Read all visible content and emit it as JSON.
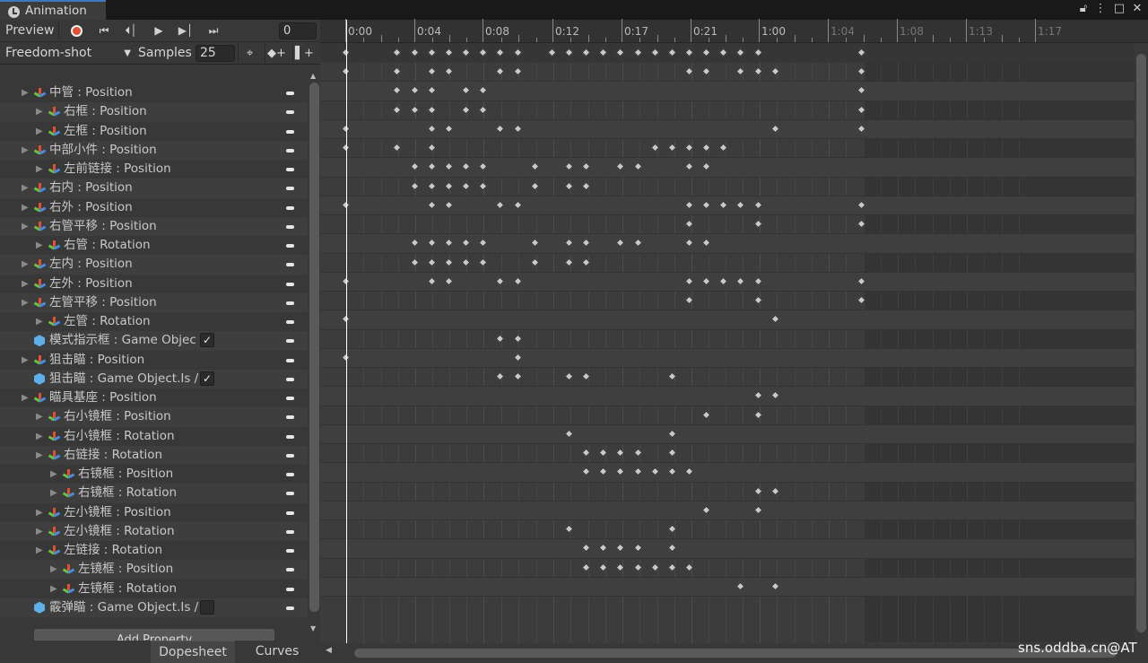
{
  "window": {
    "tab_title": "Animation"
  },
  "toolbar": {
    "preview_label": "Preview",
    "frame_value": "0"
  },
  "clip": {
    "name": "Freedom-shot",
    "samples_label": "Samples",
    "samples_value": "25"
  },
  "footer": {
    "add_property": "Add Property",
    "tabs": [
      "Dopesheet",
      "Curves"
    ]
  },
  "timeline": {
    "ticks": [
      "0:00",
      "0:04",
      "0:08",
      "0:12",
      "0:17",
      "0:21",
      "1:00",
      "1:04",
      "1:08",
      "1:13",
      "1:17"
    ]
  },
  "watermark": "sns.oddba.cn@AT",
  "colors": {
    "record": "#e0512f",
    "accent": "#3a79bb",
    "keyframe": "#c9c9c9"
  },
  "summary_keys": [
    0,
    0.075,
    0.1,
    0.125,
    0.15,
    0.175,
    0.2,
    0.225,
    0.25,
    0.3,
    0.325,
    0.35,
    0.375,
    0.4,
    0.425,
    0.45,
    0.475,
    0.5,
    0.525,
    0.55,
    0.575,
    0.6,
    0.75
  ],
  "rows": [
    {
      "label": "中管 : Position",
      "indent": 0,
      "icon": "transform",
      "foldable": true,
      "keys": [
        0,
        0.075,
        0.125,
        0.15,
        0.225,
        0.25,
        0.5,
        0.525,
        0.575,
        0.6,
        0.625,
        0.75
      ]
    },
    {
      "label": "右框 : Position",
      "indent": 1,
      "icon": "transform",
      "foldable": true,
      "keys": [
        0.075,
        0.1,
        0.125,
        0.175,
        0.2,
        0.75
      ]
    },
    {
      "label": "左框 : Position",
      "indent": 1,
      "icon": "transform",
      "foldable": true,
      "keys": [
        0.075,
        0.1,
        0.125,
        0.175,
        0.2,
        0.75
      ]
    },
    {
      "label": "中部小件 : Position",
      "indent": 0,
      "icon": "transform",
      "foldable": true,
      "keys": [
        0,
        0.125,
        0.15,
        0.225,
        0.25,
        0.625,
        0.75
      ]
    },
    {
      "label": "左前链接 : Position",
      "indent": 1,
      "icon": "transform",
      "foldable": true,
      "keys": [
        0,
        0.075,
        0.125,
        0.45,
        0.475,
        0.5,
        0.525,
        0.55
      ]
    },
    {
      "label": "右内 : Position",
      "indent": 0,
      "icon": "transform",
      "foldable": true,
      "keys": [
        0.1,
        0.125,
        0.15,
        0.175,
        0.2,
        0.275,
        0.325,
        0.35,
        0.4,
        0.425,
        0.5,
        0.525
      ]
    },
    {
      "label": "右外 : Position",
      "indent": 0,
      "icon": "transform",
      "foldable": true,
      "keys": [
        0.1,
        0.125,
        0.15,
        0.175,
        0.2,
        0.275,
        0.325,
        0.35
      ]
    },
    {
      "label": "右管平移 : Position",
      "indent": 0,
      "icon": "transform",
      "foldable": true,
      "keys": [
        0,
        0.125,
        0.15,
        0.225,
        0.25,
        0.5,
        0.525,
        0.55,
        0.575,
        0.6,
        0.75
      ]
    },
    {
      "label": "右管 : Rotation",
      "indent": 1,
      "icon": "transform",
      "foldable": true,
      "keys": [
        0.5,
        0.6,
        0.75
      ]
    },
    {
      "label": "左内 : Position",
      "indent": 0,
      "icon": "transform",
      "foldable": true,
      "keys": [
        0.1,
        0.125,
        0.15,
        0.175,
        0.2,
        0.275,
        0.325,
        0.35,
        0.4,
        0.425,
        0.5,
        0.525
      ]
    },
    {
      "label": "左外 : Position",
      "indent": 0,
      "icon": "transform",
      "foldable": true,
      "keys": [
        0.1,
        0.125,
        0.15,
        0.175,
        0.2,
        0.275,
        0.325,
        0.35
      ]
    },
    {
      "label": "左管平移 : Position",
      "indent": 0,
      "icon": "transform",
      "foldable": true,
      "keys": [
        0,
        0.125,
        0.15,
        0.225,
        0.25,
        0.5,
        0.525,
        0.55,
        0.575,
        0.6,
        0.75
      ]
    },
    {
      "label": "左管 : Rotation",
      "indent": 1,
      "icon": "transform",
      "foldable": true,
      "keys": [
        0.5,
        0.6,
        0.75
      ]
    },
    {
      "label": "模式指示框 : Game Objec",
      "indent": 0,
      "icon": "gameobject",
      "foldable": false,
      "checkbox": "✓",
      "keys": [
        0,
        0.625
      ]
    },
    {
      "label": "狙击瞄 : Position",
      "indent": 0,
      "icon": "transform",
      "foldable": true,
      "keys": [
        0.225,
        0.25
      ]
    },
    {
      "label": "狙击瞄 : Game Object.Is /",
      "indent": 0,
      "icon": "gameobject",
      "foldable": false,
      "checkbox": "✓",
      "keys": [
        0,
        0.25
      ]
    },
    {
      "label": "瞄具基座 : Position",
      "indent": 0,
      "icon": "transform",
      "foldable": true,
      "keys": [
        0.225,
        0.25,
        0.325,
        0.35,
        0.475
      ]
    },
    {
      "label": "右小镜框 : Position",
      "indent": 1,
      "icon": "transform",
      "foldable": true,
      "keys": [
        0.6,
        0.625
      ]
    },
    {
      "label": "右小镜框 : Rotation",
      "indent": 1,
      "icon": "transform",
      "foldable": true,
      "keys": [
        0.525,
        0.6
      ]
    },
    {
      "label": "右链接 : Rotation",
      "indent": 1,
      "icon": "transform",
      "foldable": true,
      "keys": [
        0.325,
        0.475
      ]
    },
    {
      "label": "右镜框 : Position",
      "indent": 2,
      "icon": "transform",
      "foldable": true,
      "keys": [
        0.35,
        0.375,
        0.4,
        0.425,
        0.475
      ]
    },
    {
      "label": "右镜框 : Rotation",
      "indent": 2,
      "icon": "transform",
      "foldable": true,
      "keys": [
        0.35,
        0.375,
        0.4,
        0.425,
        0.45,
        0.475,
        0.5
      ]
    },
    {
      "label": "左小镜框 : Position",
      "indent": 1,
      "icon": "transform",
      "foldable": true,
      "keys": [
        0.6,
        0.625
      ]
    },
    {
      "label": "左小镜框 : Rotation",
      "indent": 1,
      "icon": "transform",
      "foldable": true,
      "keys": [
        0.525,
        0.6
      ]
    },
    {
      "label": "左链接 : Rotation",
      "indent": 1,
      "icon": "transform",
      "foldable": true,
      "keys": [
        0.325,
        0.475
      ]
    },
    {
      "label": "左镜框 : Position",
      "indent": 2,
      "icon": "transform",
      "foldable": true,
      "keys": [
        0.35,
        0.375,
        0.4,
        0.425,
        0.475
      ]
    },
    {
      "label": "左镜框 : Rotation",
      "indent": 2,
      "icon": "transform",
      "foldable": true,
      "keys": [
        0.35,
        0.375,
        0.4,
        0.425,
        0.45,
        0.475,
        0.5
      ]
    },
    {
      "label": "霰弹瞄 : Game Object.Is /",
      "indent": 0,
      "icon": "gameobject",
      "foldable": false,
      "checkbox": "",
      "keys": [
        0.575,
        0.625
      ]
    }
  ]
}
